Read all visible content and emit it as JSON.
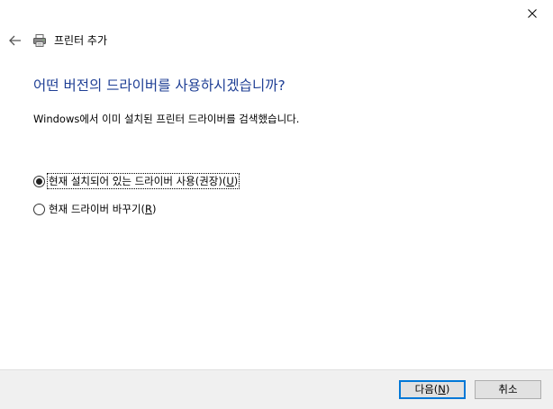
{
  "window": {
    "title": "프린터 추가",
    "close_icon": "close-icon",
    "back_icon": "back-arrow-icon",
    "printer_icon": "printer-icon"
  },
  "main": {
    "heading": "어떤 버전의 드라이버를 사용하시겠습니까?",
    "description": "Windows에서 이미 설치된 프린터 드라이버를 검색했습니다.",
    "options": [
      {
        "label": "현재 설치되어 있는 드라이버 사용(권장)(",
        "mnemonic": "U",
        "suffix": ")",
        "selected": true
      },
      {
        "label": "현재 드라이버 바꾸기(",
        "mnemonic": "R",
        "suffix": ")",
        "selected": false
      }
    ]
  },
  "footer": {
    "next": {
      "label": "다음(",
      "mnemonic": "N",
      "suffix": ")"
    },
    "cancel": {
      "label": "취소"
    }
  },
  "colors": {
    "heading": "#1f3f95",
    "footer_bg": "#f0f0f0",
    "accent": "#0078d7"
  }
}
